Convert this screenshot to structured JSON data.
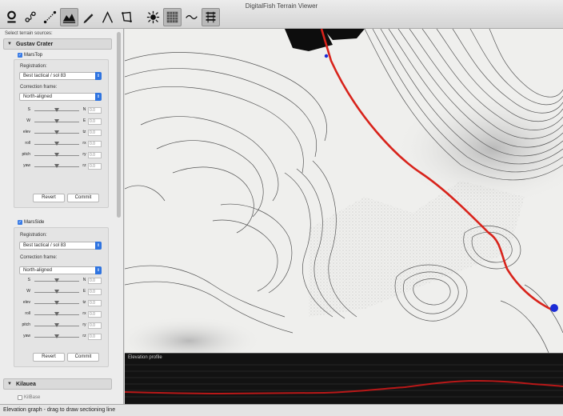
{
  "window": {
    "title": "DigitalFish Terrain Viewer"
  },
  "toolbar": {
    "tools": [
      {
        "name": "pin-icon",
        "selected": false
      },
      {
        "name": "path-icon",
        "selected": false
      },
      {
        "name": "measure-line-icon",
        "selected": false
      },
      {
        "name": "terrain-icon",
        "selected": true
      },
      {
        "name": "pencil-icon",
        "selected": false
      },
      {
        "name": "angle-icon",
        "selected": false
      },
      {
        "name": "polygon-icon",
        "selected": false
      },
      {
        "name": "sun-icon",
        "selected": false
      },
      {
        "name": "texture-icon",
        "selected": true
      },
      {
        "name": "curve-icon",
        "selected": false
      },
      {
        "name": "layers-icon",
        "selected": true
      }
    ]
  },
  "sidebar": {
    "sources_label": "Select terrain sources:",
    "groups": [
      {
        "name": "Gustav Crater",
        "sources": [
          {
            "name": "MarsTop",
            "checked": true,
            "registration_label": "Registration:",
            "registration_value": "Best tactical / sol 83",
            "frame_label": "Correction frame:",
            "frame_value": "North-aligned",
            "sliders": [
              {
                "left": "S",
                "right": "N",
                "value": "0.0"
              },
              {
                "left": "W",
                "right": "E",
                "value": "0.0"
              },
              {
                "left": "elev",
                "right": "tz",
                "value": "0.0"
              },
              {
                "left": "roll",
                "right": "rx",
                "value": "0.0"
              },
              {
                "left": "pitch",
                "right": "ry",
                "value": "0.0"
              },
              {
                "left": "yaw",
                "right": "rz",
                "value": "0.0"
              }
            ],
            "revert_label": "Revert",
            "commit_label": "Commit"
          },
          {
            "name": "MarsSide",
            "checked": true,
            "registration_label": "Registration:",
            "registration_value": "Best tactical / sol 83",
            "frame_label": "Correction frame:",
            "frame_value": "North-aligned",
            "sliders": [
              {
                "left": "S",
                "right": "N",
                "value": "0.0"
              },
              {
                "left": "W",
                "right": "E",
                "value": "0.0"
              },
              {
                "left": "elev",
                "right": "tz",
                "value": "0.0"
              },
              {
                "left": "roll",
                "right": "rx",
                "value": "0.0"
              },
              {
                "left": "pitch",
                "right": "ry",
                "value": "0.0"
              },
              {
                "left": "yaw",
                "right": "rz",
                "value": "0.0"
              }
            ],
            "revert_label": "Revert",
            "commit_label": "Commit"
          }
        ]
      },
      {
        "name": "Kilauea",
        "sources": [
          {
            "name": "KilBase",
            "checked": false
          }
        ]
      }
    ]
  },
  "profile": {
    "title": "Elevation profile"
  },
  "status": {
    "text": "Elevation graph - drag to draw sectioning line"
  },
  "colors": {
    "section_line": "#d8231b",
    "endpoint": "#1a2bd6",
    "profile_line": "#b81818"
  }
}
